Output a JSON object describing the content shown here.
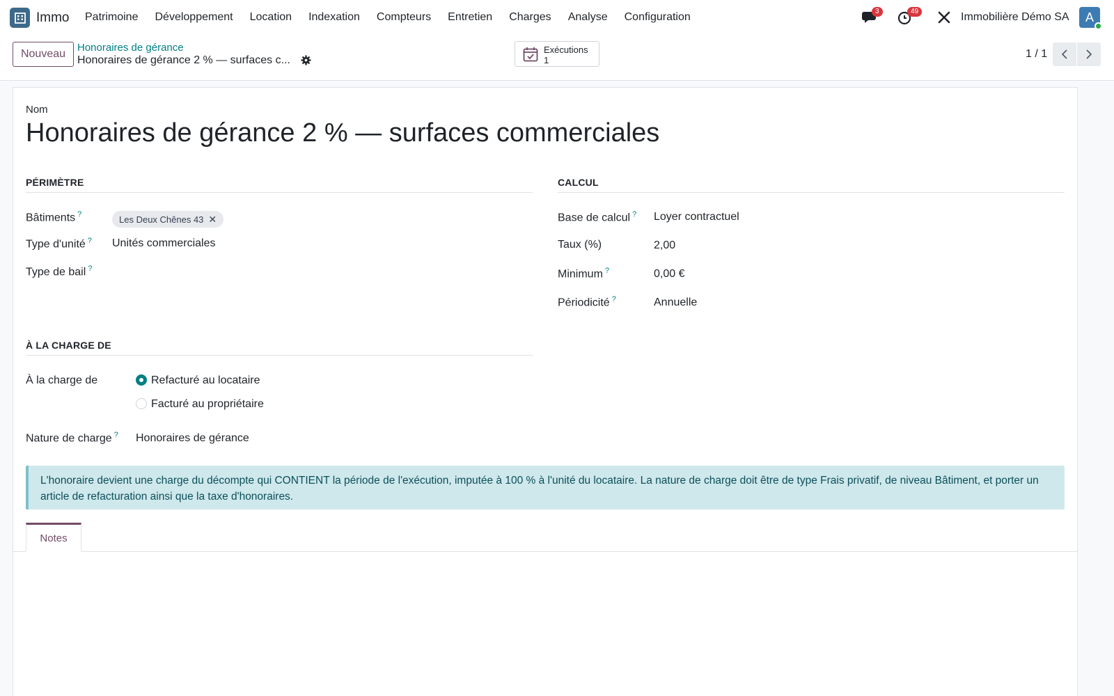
{
  "navbar": {
    "app_name": "Immo",
    "menu": [
      "Patrimoine",
      "Développement",
      "Location",
      "Indexation",
      "Compteurs",
      "Entretien",
      "Charges",
      "Analyse",
      "Configuration"
    ],
    "messages_count": "3",
    "activities_count": "49",
    "company": "Immobilière Démo SA",
    "avatar_letter": "A"
  },
  "control": {
    "new_label": "Nouveau",
    "breadcrumb_parent": "Honoraires de gérance",
    "breadcrumb_current": "Honoraires de gérance 2 % — surfaces c...",
    "smart_button": {
      "label": "Exécutions",
      "value": "1"
    },
    "pager": "1 / 1"
  },
  "form": {
    "name_label": "Nom",
    "name_value": "Honoraires de gérance 2 % — surfaces commerciales",
    "perimetre": {
      "title": "PÉRIMÈTRE",
      "batiments_label": "Bâtiments",
      "batiments_tag": "Les Deux Chênes 43",
      "type_unite_label": "Type d'unité",
      "type_unite_value": "Unités commerciales",
      "type_bail_label": "Type de bail"
    },
    "calcul": {
      "title": "CALCUL",
      "base_label": "Base de calcul",
      "base_value": "Loyer contractuel",
      "taux_label": "Taux (%)",
      "taux_value": "2,00",
      "minimum_label": "Minimum",
      "minimum_value": "0,00 €",
      "periodicite_label": "Périodicité",
      "periodicite_value": "Annuelle"
    },
    "charge": {
      "title": "À LA CHARGE DE",
      "label": "À la charge de",
      "option_1": "Refacturé au locataire",
      "option_2": "Facturé au propriétaire",
      "selected": "Refacturé au locataire",
      "nature_label": "Nature de charge",
      "nature_value": "Honoraires de gérance"
    },
    "info": "L'honoraire devient une charge du décompte qui CONTIENT la période de l'exécution, imputée à 100 % à l'unité du locataire. La nature de charge doit être de type Frais privatif, de niveau Bâtiment, et porter un article de refacturation ainsi que la taxe d'honoraires.",
    "tab_notes": "Notes"
  },
  "help_mark": "?",
  "colors": {
    "primary": "#714b67",
    "accent": "#017e84",
    "badge": "#d9363e"
  }
}
